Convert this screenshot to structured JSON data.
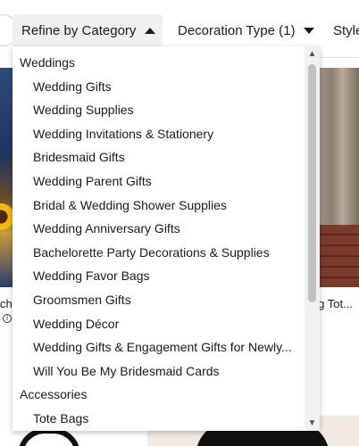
{
  "filters": {
    "category": "Refine by Category",
    "decoration": "Decoration Type (1)",
    "style": "Style"
  },
  "background": {
    "left_title_fragment": "cha",
    "right_title_fragment": "ing Tot..."
  },
  "dropdown": {
    "groups": [
      {
        "label": "Weddings",
        "items": [
          "Wedding Gifts",
          "Wedding Supplies",
          "Wedding Invitations & Stationery",
          "Bridesmaid Gifts",
          "Wedding Parent Gifts",
          "Bridal & Wedding Shower Supplies",
          "Wedding Anniversary Gifts",
          "Bachelorette Party Decorations & Supplies",
          "Wedding Favor Bags",
          "Groomsmen Gifts",
          "Wedding Décor",
          "Wedding Gifts & Engagement Gifts for Newly...",
          "Will You Be My Bridesmaid Cards"
        ]
      },
      {
        "label": "Accessories",
        "items": [
          "Tote Bags"
        ]
      }
    ]
  },
  "icons": {
    "caret_up": "caret-up-icon",
    "caret_down": "caret-down-icon",
    "info": "info-icon",
    "scroll_up": "scroll-up-arrow-icon",
    "scroll_down": "scroll-down-arrow-icon"
  }
}
